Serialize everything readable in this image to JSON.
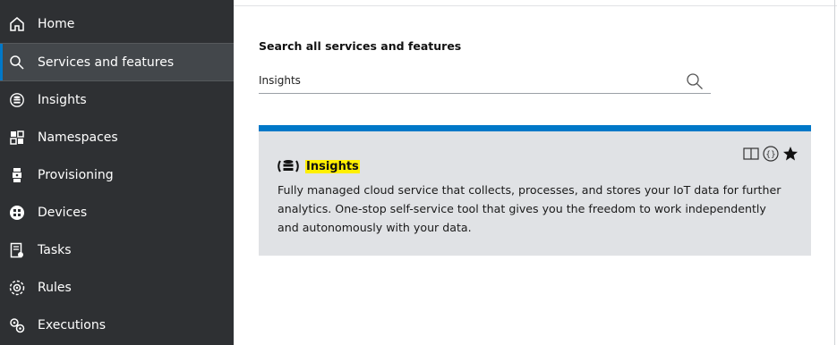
{
  "sidebar": {
    "items": [
      {
        "label": "Home",
        "icon": "home-icon"
      },
      {
        "label": "Services and features",
        "icon": "search-icon",
        "active": true
      },
      {
        "label": "Insights",
        "icon": "insights-icon"
      },
      {
        "label": "Namespaces",
        "icon": "namespaces-icon"
      },
      {
        "label": "Provisioning",
        "icon": "provisioning-icon"
      },
      {
        "label": "Devices",
        "icon": "devices-icon"
      },
      {
        "label": "Tasks",
        "icon": "tasks-icon"
      },
      {
        "label": "Rules",
        "icon": "rules-icon"
      },
      {
        "label": "Executions",
        "icon": "executions-icon"
      }
    ]
  },
  "main": {
    "search_title": "Search all services and features",
    "search_value": "Insights",
    "result": {
      "title": "Insights",
      "description": "Fully managed cloud service that collects, processes, and stores your IoT data for further analytics. One-stop self-service tool that gives you the freedom to work independently and autonomously with your data.",
      "actions": [
        "book-icon",
        "api-icon",
        "star-icon"
      ]
    }
  },
  "colors": {
    "sidebar_bg": "#2e3033",
    "active_bg": "#43474b",
    "accent": "#0078c8",
    "highlight": "#ffef00",
    "card_bg": "#e0e2e5"
  }
}
